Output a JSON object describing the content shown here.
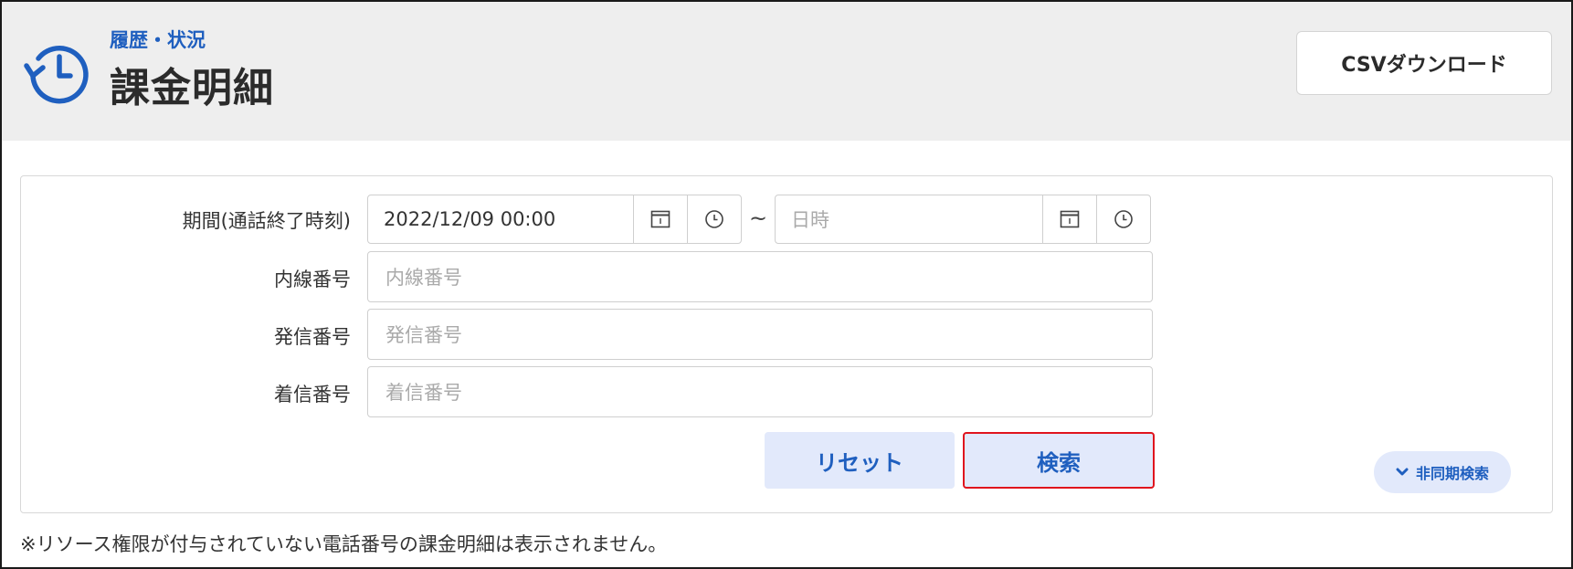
{
  "header": {
    "breadcrumb": "履歴・状況",
    "title": "課金明細",
    "csv_button": "CSVダウンロード",
    "icon": "history-icon"
  },
  "form": {
    "period": {
      "label": "期間(通話終了時刻)",
      "from_value": "2022/12/09 00:00",
      "separator": "~",
      "to_placeholder": "日時"
    },
    "extension": {
      "label": "内線番号",
      "placeholder": "内線番号"
    },
    "caller": {
      "label": "発信番号",
      "placeholder": "発信番号"
    },
    "callee": {
      "label": "着信番号",
      "placeholder": "着信番号"
    },
    "reset_button": "リセット",
    "search_button": "検索",
    "async_search_button": "非同期検索"
  },
  "footnote": "※リソース権限が付与されていない電話番号の課金明細は表示されません。",
  "colors": {
    "accent": "#1f5fbf",
    "button_bg": "#e2e9fb",
    "highlight_border": "#e0141e",
    "header_bg": "#eeeeee"
  }
}
